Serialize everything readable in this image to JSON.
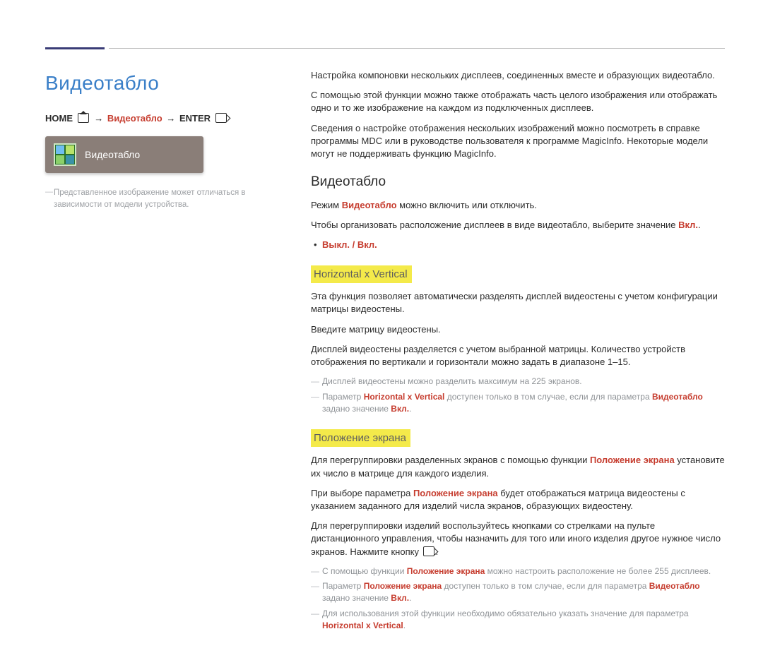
{
  "left": {
    "page_title": "Видеотабло",
    "breadcrumb": {
      "home": "HOME",
      "item": "Видеотабло",
      "enter": "ENTER",
      "arrow": "→"
    },
    "tile_label": "Видеотабло",
    "disclaimer": "Представленное изображение может отличаться в зависимости от модели устройства."
  },
  "intro": {
    "p1": "Настройка компоновки нескольких дисплеев, соединенных вместе и образующих видеотабло.",
    "p2": "С помощью этой функции можно также отображать часть целого изображения или отображать одно и то же изображение на каждом из подключенных дисплеев.",
    "p3": "Сведения о настройке отображения нескольких изображений можно посмотреть в справке программы MDC или в руководстве пользователя к программе MagicInfo. Некоторые модели могут не поддерживать функцию MagicInfo."
  },
  "s1": {
    "title": "Видеотабло",
    "p1_a": "Режим ",
    "p1_b": "Видеотабло",
    "p1_c": " можно включить или отключить.",
    "p2_a": "Чтобы организовать расположение дисплеев в виде видеотабло, выберите значение ",
    "p2_b": "Вкл.",
    "p2_c": ".",
    "bullet": "Выкл. / Вкл."
  },
  "s2": {
    "title": "Horizontal x Vertical",
    "p1": "Эта функция позволяет автоматически разделять дисплей видеостены с учетом конфигурации матрицы видеостены.",
    "p2": "Введите матрицу видеостены.",
    "p3": "Дисплей видеостены разделяется с учетом выбранной матрицы. Количество устройств отображения по вертикали и горизонтали можно задать в диапазоне 1–15.",
    "n1": "Дисплей видеостены можно разделить максимум на 225 экранов.",
    "n2_a": "Параметр ",
    "n2_b": "Horizontal x Vertical",
    "n2_c": " доступен только в том случае, если для параметра ",
    "n2_d": "Видеотабло",
    "n2_e": " задано значение ",
    "n2_f": "Вкл.",
    "n2_g": "."
  },
  "s3": {
    "title": "Положение экрана",
    "p1_a": "Для перегруппировки разделенных экранов с помощью функции ",
    "p1_b": "Положение экрана",
    "p1_c": " установите их число в матрице для каждого изделия.",
    "p2_a": "При выборе параметра ",
    "p2_b": "Положение экрана",
    "p2_c": " будет отображаться матрица видеостены с указанием заданного для изделий числа экранов, образующих видеостену.",
    "p3_a": "Для перегруппировки изделий воспользуйтесь кнопками со стрелками на пульте дистанционного управления, чтобы назначить для того или иного изделия другое нужное число экранов. Нажмите кнопку ",
    "p3_b": ".",
    "n1_a": "С помощью функции ",
    "n1_b": "Положение экрана",
    "n1_c": " можно настроить расположение не более 255 дисплеев.",
    "n2_a": "Параметр ",
    "n2_b": "Положение экрана",
    "n2_c": " доступен только в том случае, если для параметра ",
    "n2_d": "Видеотабло",
    "n2_e": " задано значение ",
    "n2_f": "Вкл.",
    "n2_g": ".",
    "n3_a": "Для использования этой функции необходимо обязательно указать значение для параметра ",
    "n3_b": "Horizontal x Vertical",
    "n3_c": "."
  }
}
